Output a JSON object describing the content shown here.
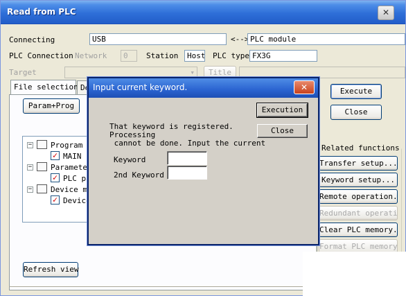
{
  "window": {
    "title": "Read from PLC"
  },
  "connection": {
    "connecting_label": "Connecting",
    "connecting_value": "USB",
    "arrow": "<-->",
    "target_module": "PLC module",
    "plc_connection_label": "PLC Connection",
    "network_label": "Network",
    "network_value": "0",
    "station_label": "Station",
    "station_value": "Host",
    "plc_type_label": "PLC type",
    "plc_type_value": "FX3G",
    "target_label": "Target",
    "title_button": "Title"
  },
  "tabs": [
    {
      "label": "File selection"
    },
    {
      "label": "De"
    }
  ],
  "param_prog_button": "Param+Prog",
  "tree": [
    {
      "label": "Program"
    },
    {
      "label": "MAIN"
    },
    {
      "label": "Parameter"
    },
    {
      "label": "PLC pa"
    },
    {
      "label": "Device me"
    },
    {
      "label": "Device"
    }
  ],
  "refresh_button": "Refresh view",
  "right_panel": {
    "execute": "Execute",
    "close": "Close",
    "related_label": "Related functions",
    "buttons": [
      {
        "label": "Transfer setup..."
      },
      {
        "label": "Keyword setup..."
      },
      {
        "label": "Remote operation..."
      },
      {
        "label": "Redundant operation..."
      },
      {
        "label": "Clear PLC memory..."
      },
      {
        "label": "Format PLC memory..."
      }
    ]
  },
  "dialog": {
    "title": "Input current keyword.",
    "message_lines": [
      "That keyword is registered.",
      "Processing",
      " cannot be done. Input the current"
    ],
    "keyword_label": "Keyword",
    "keyword_value": "",
    "keyword2_label": "2nd Keyword",
    "keyword2_value": "",
    "execution_button": "Execution",
    "close_button": "Close"
  },
  "icons": {
    "close": "close-icon",
    "program": "program-icon",
    "parameter": "parameter-icon",
    "device_memory": "device-memory-icon",
    "checked": "checkmark-icon"
  },
  "colors": {
    "title_blue": "#2e6fd8",
    "close_red": "#c9421c",
    "check_red": "#d40000"
  }
}
